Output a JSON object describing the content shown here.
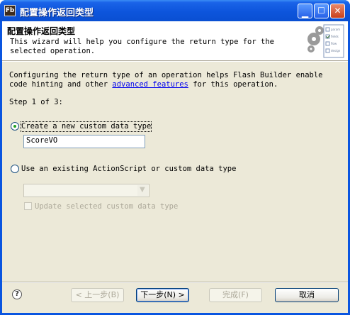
{
  "window": {
    "icon_label": "Fb",
    "title": "配置操作返回类型"
  },
  "banner": {
    "title": "配置操作返回类型",
    "description": "This wizard will help you configure the return type for the selected operation.",
    "art_items": [
      "param",
      "fields",
      "flow",
      "design"
    ]
  },
  "body": {
    "intro_before": "Configuring the return type of an operation helps Flash Builder enable code hinting and other ",
    "intro_link": "advanced features",
    "intro_after": " for this operation.",
    "step": "Step 1 of 3:",
    "option_new_label": "Create a new custom data type",
    "type_name_value": "ScoreVO",
    "option_existing_label": "Use an existing ActionScript or custom data type",
    "existing_combo_value": "",
    "update_checkbox_label": "Update selected custom data type"
  },
  "footer": {
    "help": "?",
    "back": "< 上一步(B)",
    "next": "下一步(N) >",
    "finish": "完成(F)",
    "cancel": "取消"
  }
}
